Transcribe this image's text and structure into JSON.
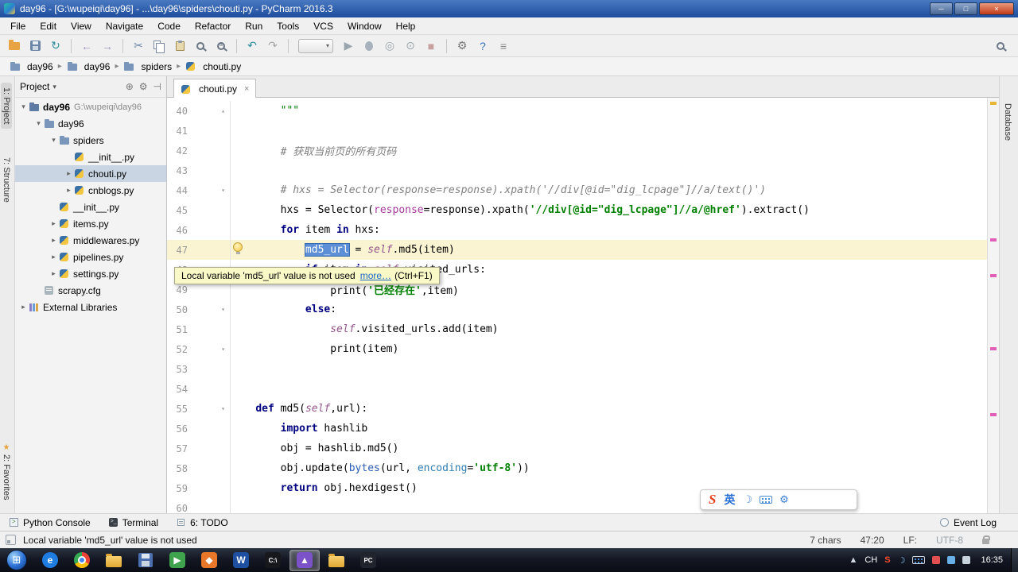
{
  "window": {
    "title": "day96 - [G:\\wupeiqi\\day96] - ...\\day96\\spiders\\chouti.py - PyCharm 2016.3",
    "minimize": "─",
    "maximize": "□",
    "close": "×"
  },
  "menu": {
    "items": [
      "File",
      "Edit",
      "View",
      "Navigate",
      "Code",
      "Refactor",
      "Run",
      "Tools",
      "VCS",
      "Window",
      "Help"
    ]
  },
  "toolbar": {
    "icons": [
      {
        "n": "open-icon",
        "k": "folder"
      },
      {
        "n": "save-all-icon",
        "k": "floppy"
      },
      {
        "n": "synchronize-icon",
        "k": "g",
        "g": "↻",
        "c": "#2f8e9e"
      },
      {
        "k": "sep"
      },
      {
        "n": "back-icon",
        "k": "g",
        "g": "←",
        "c": "#9b8fb5"
      },
      {
        "n": "forward-icon",
        "k": "g",
        "g": "→",
        "c": "#9b8fb5"
      },
      {
        "k": "sep"
      },
      {
        "n": "cut-icon",
        "k": "g",
        "g": "✂",
        "c": "#6a86a8"
      },
      {
        "n": "copy-icon",
        "k": "copy"
      },
      {
        "n": "paste-icon",
        "k": "paste"
      },
      {
        "n": "find-icon",
        "k": "mag"
      },
      {
        "n": "replace-icon",
        "k": "magr"
      },
      {
        "k": "sep"
      },
      {
        "n": "undo-icon",
        "k": "g",
        "g": "↶",
        "c": "#2f8e9e"
      },
      {
        "n": "redo-icon",
        "k": "g",
        "g": "↷",
        "c": "#a8a8a8"
      },
      {
        "k": "sep"
      },
      {
        "n": "run-config-select",
        "k": "combo"
      },
      {
        "n": "run-icon",
        "k": "g",
        "g": "▶",
        "c": "#9aa5ad"
      },
      {
        "n": "debug-icon",
        "k": "bug"
      },
      {
        "n": "coverage-icon",
        "k": "g",
        "g": "◎",
        "c": "#9aa5ad"
      },
      {
        "n": "profile-icon",
        "k": "g",
        "g": "⊙",
        "c": "#9aa5ad"
      },
      {
        "n": "stop-icon",
        "k": "g",
        "g": "■",
        "c": "#c9a0a0"
      },
      {
        "k": "sep"
      },
      {
        "n": "settings-icon",
        "k": "g",
        "g": "⚙",
        "c": "#777777"
      },
      {
        "n": "help-icon",
        "k": "g",
        "g": "?",
        "c": "#3a78c2"
      },
      {
        "n": "plugins-icon",
        "k": "g",
        "g": "≡",
        "c": "#888888"
      }
    ]
  },
  "navbar": {
    "sep": "▸",
    "crumbs": [
      {
        "label": "day96",
        "icon": "folder"
      },
      {
        "label": "day96",
        "icon": "folder"
      },
      {
        "label": "spiders",
        "icon": "folder"
      },
      {
        "label": "chouti.py",
        "icon": "py"
      }
    ]
  },
  "left_strip": {
    "tabs": [
      {
        "label": "1: Project",
        "active": true
      },
      {
        "label": "7: Structure",
        "active": false
      },
      {
        "label": "2: Favorites",
        "active": false
      }
    ]
  },
  "right_strip": {
    "tabs": [
      {
        "label": "Database"
      }
    ]
  },
  "project": {
    "header": {
      "title": "Project",
      "chevron": "▾",
      "icons": [
        {
          "n": "locate-icon",
          "g": "⊕"
        },
        {
          "n": "gear-icon",
          "g": "⚙"
        },
        {
          "n": "hide-panel-icon",
          "g": "⊣"
        }
      ]
    },
    "tree": [
      {
        "label": "day96",
        "sub": "G:\\wupeiqi\\day96",
        "level": 0,
        "icon": "folder-project",
        "arrow": "down",
        "bold": true
      },
      {
        "label": "day96",
        "level": 1,
        "icon": "folder",
        "arrow": "down"
      },
      {
        "label": "spiders",
        "level": 2,
        "icon": "folder",
        "arrow": "down"
      },
      {
        "label": "__init__.py",
        "level": 3,
        "icon": "py",
        "arrow": "none"
      },
      {
        "label": "chouti.py",
        "level": 3,
        "icon": "py",
        "arrow": "right",
        "selected": true
      },
      {
        "label": "cnblogs.py",
        "level": 3,
        "icon": "py",
        "arrow": "right"
      },
      {
        "label": "__init__.py",
        "level": 2,
        "icon": "py",
        "arrow": "none"
      },
      {
        "label": "items.py",
        "level": 2,
        "icon": "py",
        "arrow": "right"
      },
      {
        "label": "middlewares.py",
        "level": 2,
        "icon": "py",
        "arrow": "right"
      },
      {
        "label": "pipelines.py",
        "level": 2,
        "icon": "py",
        "arrow": "right"
      },
      {
        "label": "settings.py",
        "level": 2,
        "icon": "py",
        "arrow": "right"
      },
      {
        "label": "scrapy.cfg",
        "level": 1,
        "icon": "cfg",
        "arrow": "none"
      },
      {
        "label": "External Libraries",
        "level": 0,
        "icon": "lib",
        "arrow": "right"
      }
    ]
  },
  "editor": {
    "tab": {
      "label": "chouti.py",
      "close": "×"
    },
    "tooltip": {
      "text": "Local variable 'md5_url' value is not used",
      "link": "more…",
      "shortcut": "(Ctrl+F1)"
    },
    "lines": [
      {
        "n": 40,
        "fold": "▴",
        "seg": [
          [
            "        \"\"\"",
            "doc"
          ]
        ]
      },
      {
        "n": 41,
        "seg": []
      },
      {
        "n": 42,
        "seg": [
          [
            "        # 获取当前页的所有页码",
            "com"
          ]
        ]
      },
      {
        "n": 43,
        "seg": []
      },
      {
        "n": 44,
        "fold": "▾",
        "seg": [
          [
            "        # hxs = Selector(response=response).xpath('//div[@id=\"dig_lcpage\"]//a/text()')",
            "com"
          ]
        ]
      },
      {
        "n": 45,
        "seg": [
          [
            "        hxs = Selector(",
            "pln"
          ],
          [
            "response",
            "kwa"
          ],
          [
            "=response).xpath(",
            "pln"
          ],
          [
            "'//div[@id=\"dig_lcpage\"]//a/@href'",
            "str"
          ],
          [
            ").extract()",
            "pln"
          ]
        ]
      },
      {
        "n": 46,
        "seg": [
          [
            "        ",
            "pln"
          ],
          [
            "for",
            "kw"
          ],
          [
            " item ",
            "pln"
          ],
          [
            "in",
            "kw"
          ],
          [
            " hxs:",
            "pln"
          ]
        ]
      },
      {
        "n": 47,
        "cur": true,
        "seg": [
          [
            "            ",
            "pln"
          ],
          [
            "md5_url",
            "sel"
          ],
          [
            " = ",
            "pln"
          ],
          [
            "self",
            "slf"
          ],
          [
            ".md5(item)",
            "pln"
          ]
        ]
      },
      {
        "n": 48,
        "seg": [
          [
            "            ",
            "pln"
          ],
          [
            "if",
            "kw"
          ],
          [
            " item ",
            "pln"
          ],
          [
            "in",
            "kw"
          ],
          [
            " ",
            "pln"
          ],
          [
            "self",
            "slf"
          ],
          [
            ".visited_urls:",
            "pln"
          ]
        ]
      },
      {
        "n": 49,
        "seg": [
          [
            "                print(",
            "pln"
          ],
          [
            "'已经存在'",
            "str"
          ],
          [
            ",item)",
            "pln"
          ]
        ]
      },
      {
        "n": 50,
        "fold": "▾",
        "seg": [
          [
            "            ",
            "pln"
          ],
          [
            "else",
            "kw"
          ],
          [
            ":",
            "pln"
          ]
        ]
      },
      {
        "n": 51,
        "seg": [
          [
            "                ",
            "pln"
          ],
          [
            "self",
            "slf"
          ],
          [
            ".visited_urls.add(item)",
            "pln"
          ]
        ]
      },
      {
        "n": 52,
        "fold": "▾",
        "seg": [
          [
            "                print(item)",
            "pln"
          ]
        ]
      },
      {
        "n": 53,
        "seg": []
      },
      {
        "n": 54,
        "seg": []
      },
      {
        "n": 55,
        "fold": "▾",
        "seg": [
          [
            "    ",
            "pln"
          ],
          [
            "def",
            "kw"
          ],
          [
            " md5(",
            "pln"
          ],
          [
            "self",
            "slf"
          ],
          [
            ",url):",
            "pln"
          ]
        ]
      },
      {
        "n": 56,
        "seg": [
          [
            "        ",
            "pln"
          ],
          [
            "import",
            "kw"
          ],
          [
            " hashlib",
            "pln"
          ]
        ]
      },
      {
        "n": 57,
        "seg": [
          [
            "        obj = hashlib.md5()",
            "pln"
          ]
        ]
      },
      {
        "n": 58,
        "seg": [
          [
            "        obj.update(",
            "pln"
          ],
          [
            "bytes",
            "bi"
          ],
          [
            "(url, ",
            "pln"
          ],
          [
            "encoding",
            "kwb"
          ],
          [
            "=",
            "pln"
          ],
          [
            "'utf-8'",
            "str"
          ],
          [
            "))",
            "pln"
          ]
        ]
      },
      {
        "n": 59,
        "seg": [
          [
            "        ",
            "pln"
          ],
          [
            "return",
            "kw"
          ],
          [
            " obj.hexdigest()",
            "pln"
          ]
        ]
      },
      {
        "n": 60,
        "seg": []
      }
    ]
  },
  "stripe": {
    "top": "#e8b634",
    "marks": [
      300,
      345,
      437,
      520
    ]
  },
  "ime_bar": {
    "logo": "S",
    "lang": "英",
    "icons": [
      {
        "n": "moon-icon",
        "g": "☽"
      },
      {
        "n": "keyboard-icon",
        "k": "kb"
      },
      {
        "n": "toolbox-icon",
        "g": "⚙"
      }
    ]
  },
  "bottom_bar": {
    "left": [
      {
        "label": "Python Console",
        "icon": "console"
      },
      {
        "label": "Terminal",
        "icon": "terminal"
      },
      {
        "label": "6: TODO",
        "icon": "todo"
      }
    ],
    "right": [
      {
        "label": "Event Log",
        "icon": "eventlog"
      }
    ]
  },
  "status_bar": {
    "message": "Local variable 'md5_url' value is not used",
    "chars": "7 chars",
    "position": "47:20",
    "line_sep": "LF:",
    "encoding": "UTF-8"
  },
  "taskbar": {
    "start_glyph": "⊞",
    "time": "16:35",
    "apps": [
      {
        "n": "taskbar-ie",
        "t": "e",
        "bg": "#1f7ce0",
        "circle": true
      },
      {
        "n": "taskbar-chrome",
        "cls": "chrome"
      },
      {
        "n": "taskbar-explorer",
        "cls": "tfolder"
      },
      {
        "n": "taskbar-floppy",
        "cls": "tfloppy"
      },
      {
        "n": "taskbar-media",
        "t": "▶",
        "bg": "#3fa34d"
      },
      {
        "n": "taskbar-image",
        "t": "◆",
        "bg": "#e8772a"
      },
      {
        "n": "taskbar-word",
        "t": "W",
        "bg": "#1f4fa0"
      },
      {
        "n": "taskbar-cmd",
        "t": "C:\\",
        "bg": "#17181c",
        "small": true
      },
      {
        "n": "taskbar-viewer",
        "t": "▲",
        "bg": "#7b52c8",
        "active": true
      },
      {
        "n": "taskbar-pictures",
        "cls": "tfolder"
      },
      {
        "n": "taskbar-pycharm",
        "t": "PC",
        "bg": "#20242c",
        "small": true
      }
    ],
    "tray": [
      {
        "n": "hidden-icons-button",
        "g": "▲",
        "c": "#cfd6e0"
      },
      {
        "n": "language-indicator",
        "g": "CH",
        "c": "#ffffff"
      },
      {
        "n": "sogou-tray-icon",
        "g": "S",
        "c": "#ff4a2a",
        "bold": true
      },
      {
        "n": "ime-moon-icon",
        "g": "☽",
        "c": "#8ec6f0"
      },
      {
        "n": "keyboard-tray-icon",
        "kb": true
      },
      {
        "n": "antivirus-tray-icon",
        "dot": "#e05050"
      },
      {
        "n": "network-tray-icon",
        "dot": "#6ab0e8"
      },
      {
        "n": "volume-tray-icon",
        "dot": "#c8d2dc"
      }
    ]
  },
  "colors": {
    "selection": "#5c8fd6",
    "current_line": "#fbf4d2",
    "tooltip_bg": "#f9f9c8",
    "title_bar": "#2a5fb8"
  }
}
